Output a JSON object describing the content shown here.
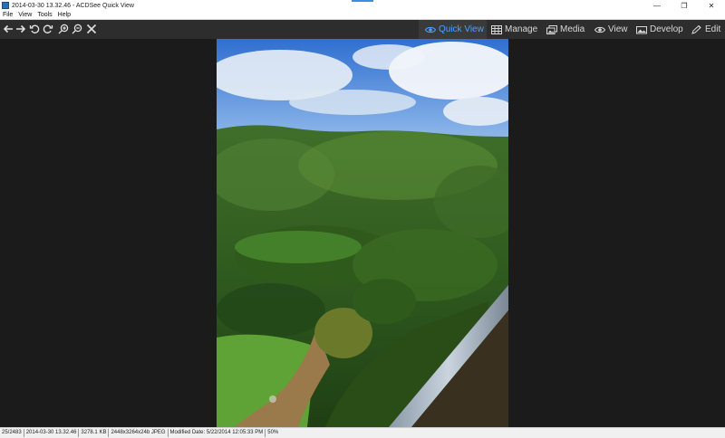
{
  "window": {
    "title": "2014-03-30 13.32.46 - ACDSee Quick View",
    "controls": [
      "minimize",
      "restore",
      "close"
    ],
    "minimize_glyph": "—",
    "restore_glyph": "❐",
    "close_glyph": "✕"
  },
  "menu": {
    "items": [
      "File",
      "View",
      "Tools",
      "Help"
    ]
  },
  "toolbar": {
    "tools": [
      {
        "name": "previous-icon"
      },
      {
        "name": "next-icon"
      },
      {
        "name": "rotate-left-icon"
      },
      {
        "name": "rotate-right-icon"
      },
      {
        "name": "zoom-in-icon"
      },
      {
        "name": "zoom-out-icon"
      },
      {
        "name": "close-icon"
      }
    ],
    "modes": [
      {
        "label": "Quick View",
        "icon": "eye-icon",
        "active": true
      },
      {
        "label": "Manage",
        "icon": "grid-icon",
        "active": false
      },
      {
        "label": "Media",
        "icon": "media-icon",
        "active": false
      },
      {
        "label": "View",
        "icon": "eye-icon",
        "active": false
      },
      {
        "label": "Develop",
        "icon": "develop-icon",
        "active": false
      },
      {
        "label": "Edit",
        "icon": "edit-icon",
        "active": false
      }
    ],
    "accent_color": "#4aa3ff"
  },
  "status": {
    "position": "25/2483",
    "filename": "2014-03-30 13.32.46",
    "filesize": "3278.1 KB",
    "dimensions": "2448x3264x24b JPEG",
    "modified": "Modified Date: 5/22/2014 12:05:33 PM",
    "zoom": "50%"
  }
}
